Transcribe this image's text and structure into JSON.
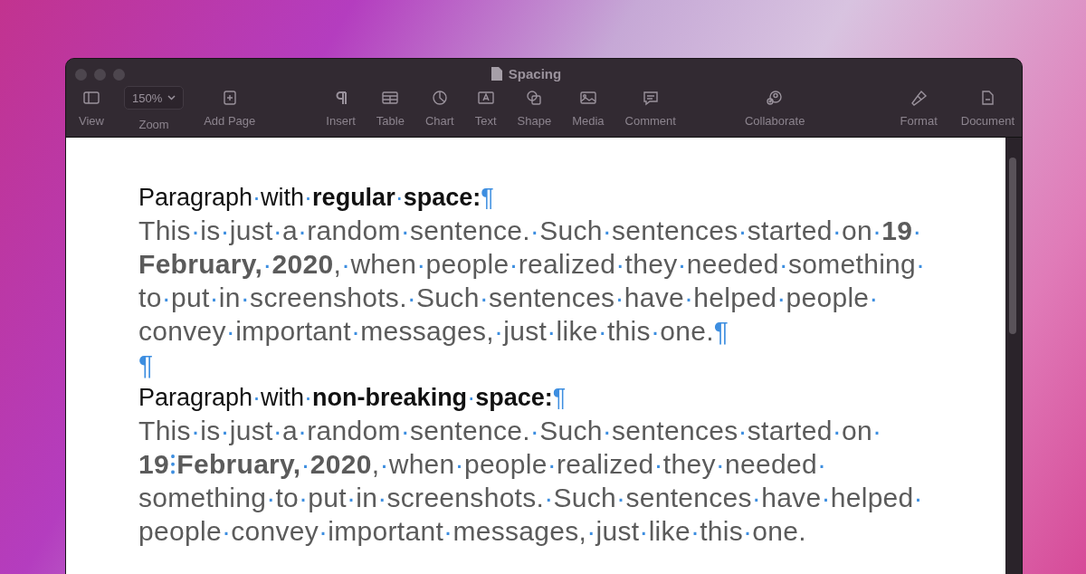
{
  "window": {
    "title": "Spacing"
  },
  "toolbar": {
    "left": [
      {
        "kind": "button",
        "label": "View"
      },
      {
        "kind": "zoom",
        "value": "150%",
        "label": "Zoom"
      },
      {
        "kind": "button",
        "label": "Add Page"
      }
    ],
    "center": [
      {
        "label": "Insert"
      },
      {
        "label": "Table"
      },
      {
        "label": "Chart"
      },
      {
        "label": "Text"
      },
      {
        "label": "Shape"
      },
      {
        "label": "Media"
      },
      {
        "label": "Comment"
      }
    ],
    "collab": {
      "label": "Collaborate"
    },
    "right": [
      {
        "label": "Format"
      },
      {
        "label": "Document"
      }
    ]
  },
  "document": {
    "paragraphs": [
      {
        "kind": "heading",
        "lines": [
          "Paragraph·with·**regular·space:**¶"
        ]
      },
      {
        "kind": "body",
        "lines": [
          "This·is·just·a·random·sentence.·Such·sentences·started·on·**19**·",
          "**February,**·**2020**,·when·people·realized·they·needed·something·",
          "to·put·in·screenshots.·Such·sentences·have·helped·people·",
          "convey·important·messages,·just·like·this·one.¶"
        ]
      },
      {
        "kind": "body",
        "lines": [
          "¶"
        ]
      },
      {
        "kind": "heading",
        "lines": [
          "Paragraph·with·**non-breaking·space:**¶"
        ]
      },
      {
        "kind": "body",
        "lines": [
          "This·is·just·a·random·sentence.·Such·sentences·started·on·",
          "**19**⁝**February,**·**2020**,·when·people·realized·they·needed·",
          "something·to·put·in·screenshots.·Such·sentences·have·helped·",
          "people·convey·important·messages,·just·like·this·one."
        ]
      }
    ]
  }
}
